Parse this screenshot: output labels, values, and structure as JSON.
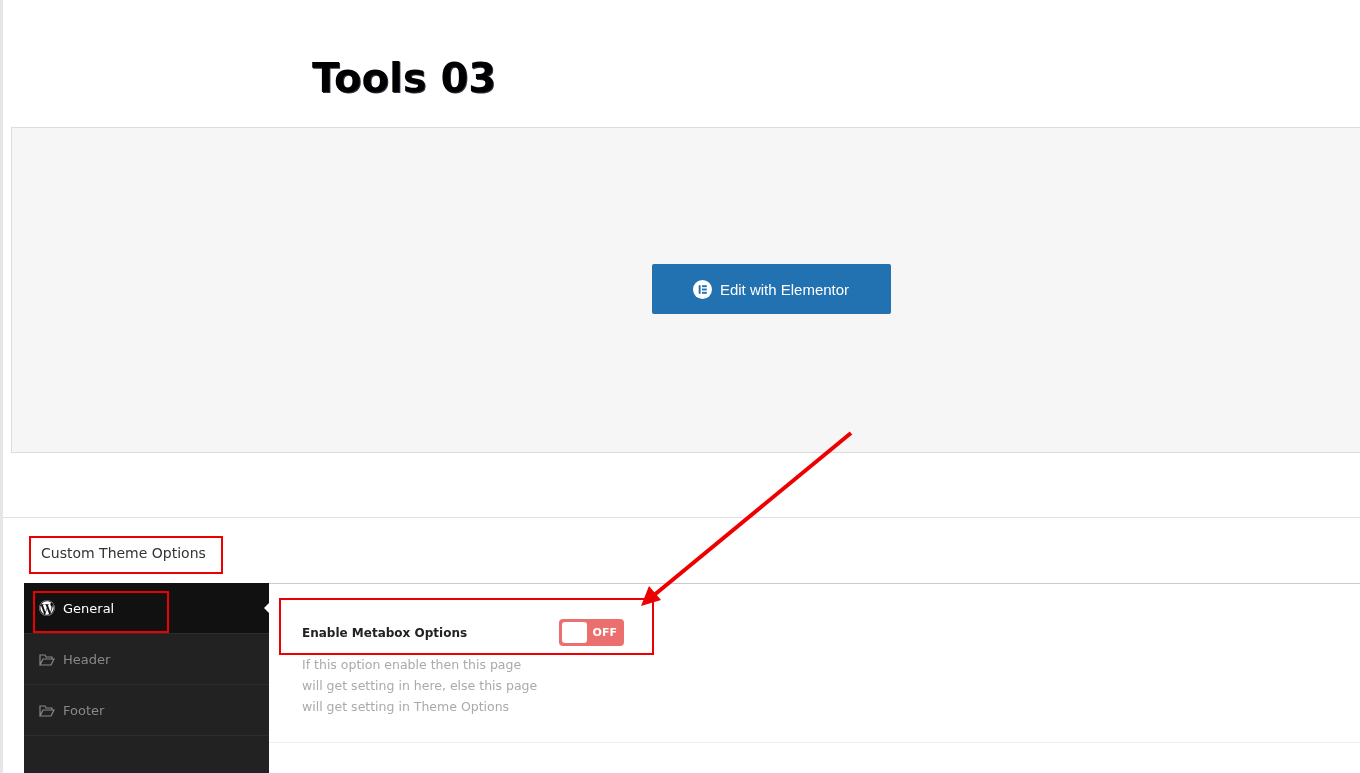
{
  "page_title": "Tools 03",
  "editor_button": {
    "label": "Edit with Elementor"
  },
  "metabox": {
    "title": "Custom Theme Options",
    "sidebar": [
      {
        "label": "General",
        "kind": "logo",
        "selected": true
      },
      {
        "label": "Header",
        "kind": "folder",
        "selected": false
      },
      {
        "label": "Footer",
        "kind": "folder",
        "selected": false
      }
    ],
    "option": {
      "label": "Enable Metabox Options",
      "on": false,
      "toggle_text": "OFF",
      "description": "If this option enable then this page will get setting in here, else this page will get setting in Theme Options"
    }
  }
}
